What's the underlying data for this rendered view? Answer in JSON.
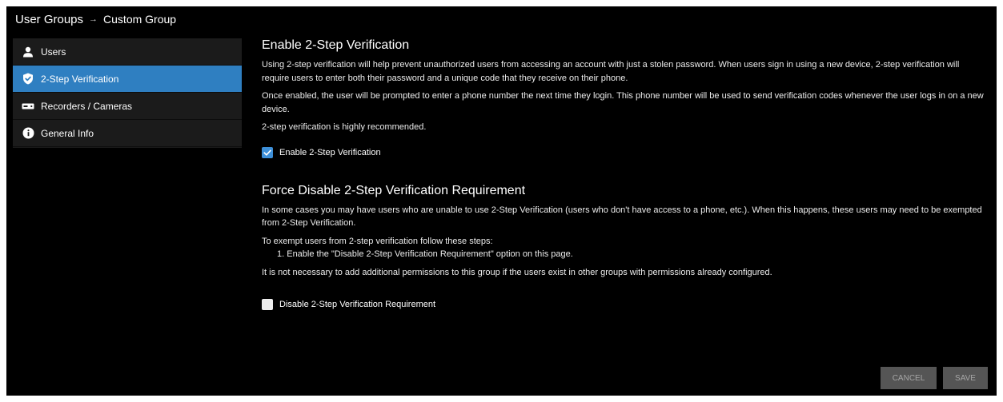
{
  "breadcrumb": {
    "parent": "User Groups",
    "separator": "→",
    "current": "Custom Group"
  },
  "sidebar": {
    "items": [
      {
        "label": "Users",
        "icon": "user-icon",
        "active": false
      },
      {
        "label": "2-Step Verification",
        "icon": "shield-check-icon",
        "active": true
      },
      {
        "label": "Recorders / Cameras",
        "icon": "recorder-icon",
        "active": false
      },
      {
        "label": "General Info",
        "icon": "info-icon",
        "active": false
      }
    ]
  },
  "section1": {
    "title": "Enable 2-Step Verification",
    "para1": "Using 2-step verification will help prevent unauthorized users from accessing an account with just a stolen password. When users sign in using a new device, 2-step verification will require users to enter both their password and a unique code that they receive on their phone.",
    "para2": "Once enabled, the user will be prompted to enter a phone number the next time they login. This phone number will be used to send verification codes whenever the user logs in on a new device.",
    "para3": "2-step verification is highly recommended.",
    "checkbox_label": "Enable 2-Step Verification",
    "checked": true
  },
  "section2": {
    "title": "Force Disable 2-Step Verification Requirement",
    "para1": "In some cases you may have users who are unable to use 2-Step Verification (users who don't have access to a phone, etc.). When this happens, these users may need to be exempted from 2-Step Verification.",
    "para2": "To exempt users from 2-step verification follow these steps:",
    "step1": "1. Enable the \"Disable 2-Step Verification Requirement\" option on this page.",
    "para3": "It is not necessary to add additional permissions to this group if the users exist in other groups with permissions already configured.",
    "checkbox_label": "Disable 2-Step Verification Requirement",
    "checked": false
  },
  "actions": {
    "cancel_label": "CANCEL",
    "save_label": "SAVE"
  },
  "colors": {
    "accent": "#2f7fc1",
    "checkbox_on": "#3d8fd8",
    "background": "#000000",
    "sidebar": "#1b1b1b",
    "button": "#555555"
  }
}
